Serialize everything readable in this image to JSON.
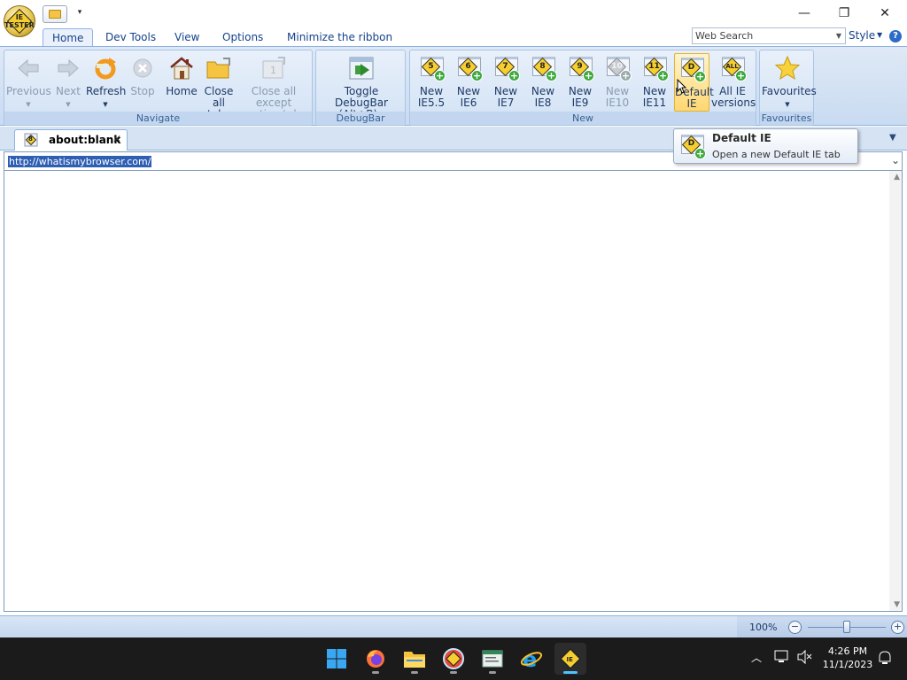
{
  "app": {
    "logo_text": "IE TESTER"
  },
  "titlebar": {
    "qat_more": "▾",
    "minimize": "—",
    "restore": "❐",
    "close": "✕"
  },
  "ribbon_tabs": [
    {
      "label": "Home",
      "active": true
    },
    {
      "label": "Dev Tools"
    },
    {
      "label": "View"
    },
    {
      "label": "Options"
    },
    {
      "label": "Minimize the ribbon"
    }
  ],
  "search": {
    "placeholder": "Web Search"
  },
  "style": {
    "label": "Style"
  },
  "groups": {
    "navigate": {
      "caption": "Navigate",
      "buttons": [
        {
          "label": "Previous",
          "enabled": false
        },
        {
          "label": "Next",
          "enabled": false
        },
        {
          "label": "Refresh",
          "enabled": true
        },
        {
          "label": "Stop",
          "enabled": false
        },
        {
          "label": "Home",
          "enabled": true
        },
        {
          "label": "Close all tabs",
          "line1": "Close",
          "line2": "all tabs",
          "enabled": true
        },
        {
          "label": "Close all except active tab",
          "line1": "Close all except",
          "line2": "active tab",
          "enabled": false
        }
      ]
    },
    "debugbar": {
      "caption": "DebugBar",
      "button": {
        "line1": "Toggle DebugBar",
        "line2": "(Alt+B)"
      }
    },
    "new": {
      "caption": "New",
      "buttons": [
        {
          "badge": "5",
          "line1": "New",
          "line2": "IE5.5",
          "enabled": true
        },
        {
          "badge": "6",
          "line1": "New",
          "line2": "IE6",
          "enabled": true
        },
        {
          "badge": "7",
          "line1": "New",
          "line2": "IE7",
          "enabled": true
        },
        {
          "badge": "8",
          "line1": "New",
          "line2": "IE8",
          "enabled": true
        },
        {
          "badge": "9",
          "line1": "New",
          "line2": "IE9",
          "enabled": true
        },
        {
          "badge": "10",
          "line1": "New",
          "line2": "IE10",
          "enabled": false
        },
        {
          "badge": "11",
          "line1": "New",
          "line2": "IE11",
          "enabled": true
        },
        {
          "badge": "D",
          "line1": "Default",
          "line2": "IE",
          "enabled": true,
          "hovered": true
        },
        {
          "badge": "ALL",
          "line1": "All IE",
          "line2": "versions",
          "enabled": true
        }
      ]
    },
    "favourites": {
      "caption": "Favourites",
      "button": {
        "label": "Favourites"
      }
    }
  },
  "tooltip": {
    "title": "Default IE",
    "description": "Open a new Default IE tab",
    "badge": "D"
  },
  "doc_tab": {
    "label": "about:blank",
    "badge": "8",
    "close": "✕"
  },
  "address": {
    "url": "http://whatismybrowser.com/"
  },
  "status": {
    "zoom": "100%"
  },
  "taskbar": {
    "apps": [
      "start",
      "firefox",
      "file-explorer",
      "ie-tester-red",
      "notepad",
      "internet-explorer",
      "ie-tester"
    ],
    "clock_time": "4:26 PM",
    "clock_date": "11/1/2023"
  },
  "colors": {
    "accent": "#15428b",
    "ribbon": "#d2e2f5",
    "taskbar": "#1b1b1b"
  }
}
